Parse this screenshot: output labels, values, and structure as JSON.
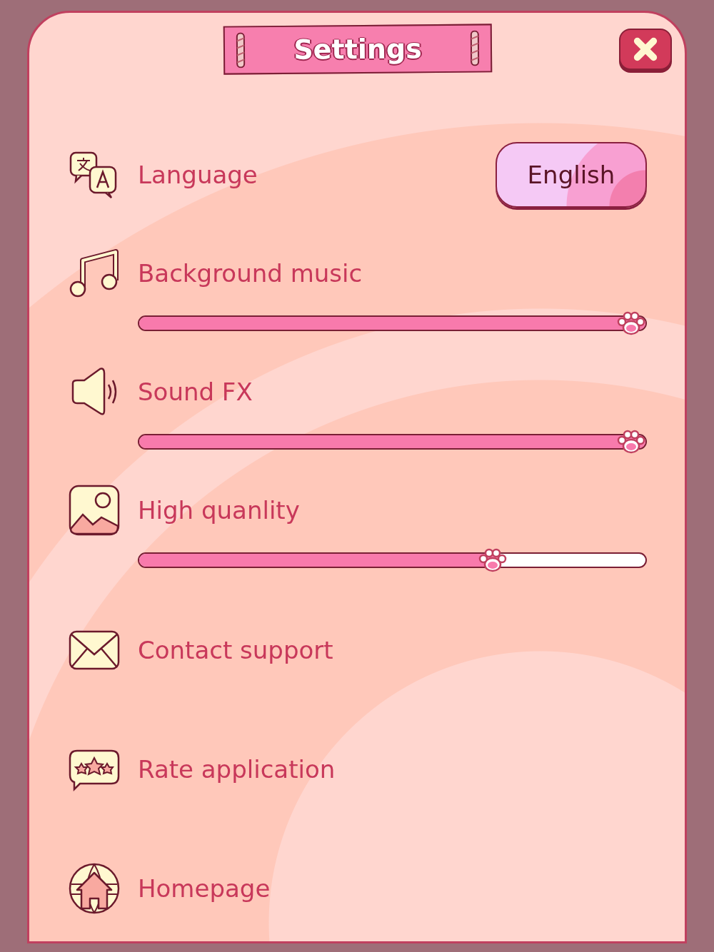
{
  "title": "Settings",
  "items": [
    {
      "kind": "select",
      "label": "Language",
      "value": "English"
    },
    {
      "kind": "slider",
      "label": "Background music",
      "level": 1
    },
    {
      "kind": "slider",
      "label": "Sound FX",
      "level": 1
    },
    {
      "kind": "slider",
      "label": "High quanlity",
      "level": 0.71
    },
    {
      "kind": "link",
      "label": "Contact support"
    },
    {
      "kind": "link",
      "label": "Rate application"
    },
    {
      "kind": "link",
      "label": "Homepage"
    }
  ]
}
